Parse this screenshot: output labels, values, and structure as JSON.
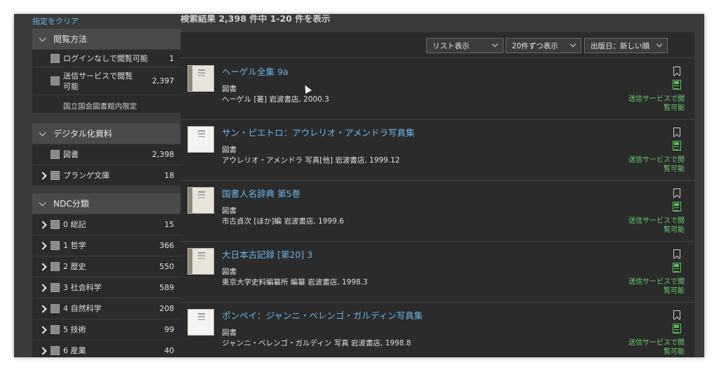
{
  "sidebar": {
    "clear_label": "指定をクリア",
    "facets": [
      {
        "title": "閲覧方法",
        "items": [
          {
            "label": "ログインなしで閲覧可能",
            "count": "1",
            "expandable": false
          },
          {
            "label": "送信サービスで閲覧可能",
            "count": "2,397",
            "expandable": false
          }
        ],
        "note": "国立国会図書館内限定"
      },
      {
        "title": "デジタル化資料",
        "items": [
          {
            "label": "図書",
            "count": "2,398",
            "expandable": false
          },
          {
            "label": "プランゲ文庫",
            "count": "18",
            "expandable": true
          }
        ]
      },
      {
        "title": "NDC分類",
        "items": [
          {
            "label": "0 総記",
            "count": "15",
            "expandable": true
          },
          {
            "label": "1 哲学",
            "count": "366",
            "expandable": true
          },
          {
            "label": "2 歴史",
            "count": "550",
            "expandable": true
          },
          {
            "label": "3 社会科学",
            "count": "589",
            "expandable": true
          },
          {
            "label": "4 自然科学",
            "count": "208",
            "expandable": true
          },
          {
            "label": "5 技術",
            "count": "99",
            "expandable": true
          },
          {
            "label": "6 産業",
            "count": "40",
            "expandable": true
          }
        ]
      }
    ]
  },
  "results_summary": "検索結果 2,398 件中 1-20 件を表示",
  "toolbar": {
    "view_select": "リスト表示",
    "per_page_select": "20件ずつ表示",
    "sort_select": "出版日：新しい順"
  },
  "results": [
    {
      "title": "ヘーゲル全集 9a",
      "type": "図書",
      "meta": "ヘーゲル [著] 岩波書店, 2000.3",
      "availability": "送信サービスで閲覧可能",
      "thumb": "bound"
    },
    {
      "title": "サン・ピエトロ：アウレリオ・アメンドラ写真集",
      "type": "図書",
      "meta": "アウレリオ・アメンドラ 写真[他] 岩波書店, 1999.12",
      "availability": "送信サービスで閲覧可能",
      "thumb": "light"
    },
    {
      "title": "国書人名辞典 第5巻",
      "type": "図書",
      "meta": "市古貞次 [ほか]編 岩波書店, 1999.6",
      "availability": "送信サービスで閲覧可能",
      "thumb": "bound"
    },
    {
      "title": "大日本古記録 [第20] 3",
      "type": "図書",
      "meta": "東京大学史料編纂所 編纂 岩波書店, 1998.3",
      "availability": "送信サービスで閲覧可能",
      "thumb": "bound"
    },
    {
      "title": "ポンペイ：ジャンニ・ベレンゴ・ガルディン写真集",
      "type": "図書",
      "meta": "ジャンニ・ベレンゴ・ガルディン 写真 岩波書店, 1998.8",
      "availability": "送信サービスで閲覧可能",
      "thumb": "light"
    }
  ],
  "colors": {
    "link": "#6fb3e6",
    "available": "#6bcb6f",
    "panel": "#2b2b2b",
    "background": "#3a3a3a"
  }
}
